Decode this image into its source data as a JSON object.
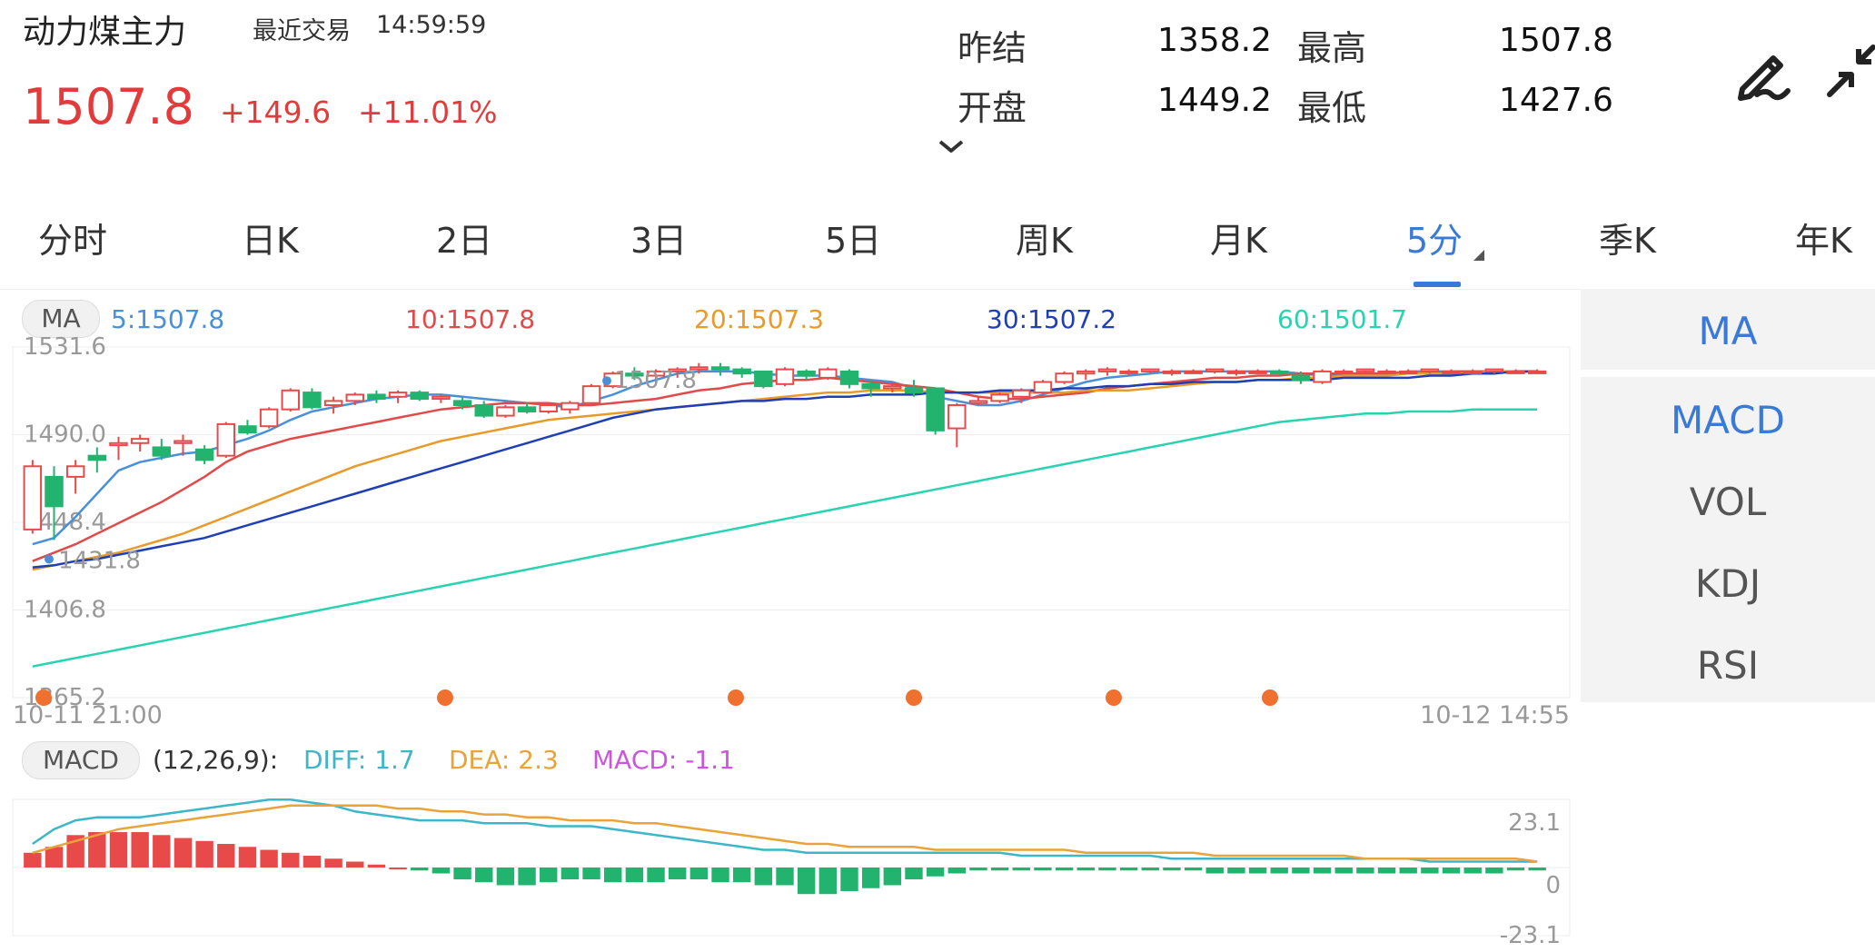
{
  "header": {
    "title": "动力煤主力",
    "last_trade_label": "最近交易",
    "last_trade_time": "14:59:59",
    "price": "1507.8",
    "change": "+149.6",
    "change_pct": "+11.01%",
    "quote": [
      {
        "label": "昨结",
        "value": "1358.2"
      },
      {
        "label": "最高",
        "value": "1507.8"
      },
      {
        "label": "开盘",
        "value": "1449.2"
      },
      {
        "label": "最低",
        "value": "1427.6"
      }
    ],
    "icons": [
      "chevron-down-icon",
      "pen-icon",
      "collapse-icon"
    ]
  },
  "tabs": {
    "items": [
      "分时",
      "日K",
      "2日",
      "3日",
      "5日",
      "周K",
      "月K",
      "5分",
      "季K",
      "年K"
    ],
    "active": "5分"
  },
  "indicators": {
    "items": [
      "MA",
      "MACD",
      "VOL",
      "KDJ",
      "RSI"
    ],
    "active_main": "MA",
    "active_sub": "MACD"
  },
  "ma_legend": {
    "label": "MA",
    "items": [
      {
        "text": "5:1507.8",
        "color": "#4a90d9"
      },
      {
        "text": "10:1507.8",
        "color": "#e04a4a"
      },
      {
        "text": "20:1507.3",
        "color": "#e89a2a"
      },
      {
        "text": "30:1507.2",
        "color": "#1f3fb4"
      },
      {
        "text": "60:1501.7",
        "color": "#29d3b0"
      }
    ]
  },
  "macd_legend": {
    "label": "MACD",
    "params": "(12,26,9):",
    "diff": "DIFF: 1.7",
    "dea": "DEA: 2.3",
    "macd": "MACD: -1.1"
  },
  "colors": {
    "up": "#e84a4a",
    "down": "#22b46e",
    "accent": "#3a7ad6",
    "ma5": "#4a90d9",
    "ma10": "#e04a4a",
    "ma20": "#e89a2a",
    "ma30": "#1f3fb4",
    "ma60": "#29d3b0",
    "diff": "#3cb6c8",
    "dea": "#e8a33a",
    "marker": "#f07030"
  },
  "chart_data": [
    {
      "type": "candlestick",
      "y_ticks": [
        1531.6,
        1490.0,
        1448.4,
        1406.8,
        1365.2
      ],
      "ylim": [
        1365.2,
        1531.6
      ],
      "x_start_label": "10-11 21:00",
      "x_end_label": "10-12 14:55",
      "annotations": {
        "high": "1507.8",
        "low": "1431.8"
      },
      "marker_count": 6,
      "candles": [
        [
          1445,
          1478,
          1443,
          1475
        ],
        [
          1470,
          1475,
          1440,
          1456
        ],
        [
          1470,
          1478,
          1462,
          1475
        ],
        [
          1480,
          1484,
          1472,
          1478
        ],
        [
          1485,
          1489,
          1478,
          1486
        ],
        [
          1486,
          1490,
          1482,
          1488
        ],
        [
          1484,
          1488,
          1478,
          1480
        ],
        [
          1486,
          1490,
          1480,
          1487
        ],
        [
          1483,
          1485,
          1476,
          1478
        ],
        [
          1480,
          1496,
          1479,
          1495
        ],
        [
          1494,
          1497,
          1490,
          1491
        ],
        [
          1494,
          1503,
          1493,
          1502
        ],
        [
          1502,
          1512,
          1501,
          1511
        ],
        [
          1510,
          1512,
          1502,
          1503
        ],
        [
          1504,
          1508,
          1500,
          1506
        ],
        [
          1506,
          1510,
          1504,
          1509
        ],
        [
          1509,
          1511,
          1505,
          1507
        ],
        [
          1508,
          1511,
          1505,
          1510
        ],
        [
          1510,
          1511,
          1506,
          1507
        ],
        [
          1507,
          1509,
          1505,
          1508
        ],
        [
          1506,
          1508,
          1502,
          1504
        ],
        [
          1504,
          1506,
          1498,
          1499
        ],
        [
          1499,
          1504,
          1498,
          1503
        ],
        [
          1503,
          1505,
          1500,
          1501
        ],
        [
          1501,
          1505,
          1500,
          1504
        ],
        [
          1502,
          1506,
          1500,
          1505
        ],
        [
          1505,
          1514,
          1504,
          1513
        ],
        [
          1513,
          1520,
          1512,
          1519
        ],
        [
          1519,
          1522,
          1516,
          1518
        ],
        [
          1518,
          1521,
          1515,
          1520
        ],
        [
          1520,
          1522,
          1517,
          1521
        ],
        [
          1521,
          1524,
          1519,
          1522
        ],
        [
          1522,
          1524,
          1518,
          1521
        ],
        [
          1521,
          1522,
          1517,
          1519
        ],
        [
          1520,
          1520,
          1512,
          1513
        ],
        [
          1514,
          1522,
          1513,
          1521
        ],
        [
          1520,
          1521,
          1516,
          1518
        ],
        [
          1517,
          1522,
          1516,
          1521
        ],
        [
          1520,
          1521,
          1512,
          1514
        ],
        [
          1514,
          1516,
          1508,
          1512
        ],
        [
          1512,
          1515,
          1510,
          1513
        ],
        [
          1512,
          1516,
          1508,
          1510
        ],
        [
          1512,
          1512,
          1490,
          1492
        ],
        [
          1493,
          1505,
          1484,
          1504
        ],
        [
          1505,
          1508,
          1504,
          1506
        ],
        [
          1506,
          1510,
          1505,
          1509
        ],
        [
          1508,
          1512,
          1505,
          1511
        ],
        [
          1510,
          1516,
          1509,
          1515
        ],
        [
          1515,
          1520,
          1514,
          1519
        ],
        [
          1519,
          1521,
          1516,
          1520
        ],
        [
          1520,
          1522,
          1518,
          1521
        ],
        [
          1520,
          1521,
          1518,
          1520
        ],
        [
          1520,
          1521,
          1519,
          1521
        ],
        [
          1520,
          1521,
          1518,
          1520
        ],
        [
          1520,
          1521,
          1519,
          1520
        ],
        [
          1520,
          1521,
          1519,
          1521
        ],
        [
          1520,
          1521,
          1518,
          1520
        ],
        [
          1520,
          1521,
          1519,
          1520
        ],
        [
          1520,
          1521,
          1518,
          1519
        ],
        [
          1518,
          1520,
          1514,
          1516
        ],
        [
          1515,
          1521,
          1514,
          1520
        ],
        [
          1520,
          1521,
          1519,
          1520
        ],
        [
          1520,
          1521,
          1519,
          1521
        ],
        [
          1520,
          1521,
          1519,
          1520
        ],
        [
          1520,
          1521,
          1519,
          1520
        ],
        [
          1520,
          1521,
          1519,
          1521
        ],
        [
          1520,
          1521,
          1519,
          1520
        ],
        [
          1520,
          1521,
          1519,
          1520
        ],
        [
          1520,
          1521,
          1519,
          1521
        ],
        [
          1520,
          1521,
          1519,
          1520
        ],
        [
          1520,
          1521,
          1519,
          1520
        ]
      ],
      "series": [
        {
          "name": "5",
          "values": [
            1438,
            1441,
            1451,
            1462,
            1473,
            1477,
            1479,
            1481,
            1482,
            1485,
            1488,
            1492,
            1497,
            1501,
            1503,
            1505,
            1507,
            1508,
            1509,
            1509,
            1508,
            1507,
            1506,
            1505,
            1504,
            1503,
            1506,
            1509,
            1513,
            1516,
            1519,
            1520,
            1520,
            1520,
            1519,
            1518,
            1518,
            1518,
            1517,
            1516,
            1515,
            1512,
            1508,
            1506,
            1504,
            1504,
            1506,
            1509,
            1512,
            1515,
            1517,
            1518,
            1519,
            1520,
            1520,
            1520,
            1520,
            1520,
            1520,
            1519,
            1518,
            1518,
            1518,
            1519,
            1520,
            1520,
            1520,
            1520,
            1520,
            1520,
            1520
          ]
        },
        {
          "name": "10",
          "values": [
            1430,
            1434,
            1438,
            1443,
            1448,
            1453,
            1458,
            1464,
            1470,
            1477,
            1482,
            1485,
            1488,
            1490,
            1492,
            1494,
            1496,
            1498,
            1500,
            1502,
            1503,
            1504,
            1505,
            1505,
            1505,
            1504,
            1504,
            1505,
            1506,
            1507,
            1509,
            1511,
            1512,
            1514,
            1515,
            1516,
            1516,
            1517,
            1516,
            1515,
            1514,
            1513,
            1512,
            1510,
            1508,
            1507,
            1507,
            1508,
            1509,
            1510,
            1512,
            1513,
            1514,
            1515,
            1516,
            1517,
            1517,
            1518,
            1518,
            1519,
            1519,
            1519,
            1519,
            1519,
            1519,
            1519,
            1520,
            1520,
            1520,
            1520,
            1520
          ]
        },
        {
          "name": "20",
          "values": [
            1426,
            1428,
            1430,
            1432,
            1434,
            1437,
            1440,
            1443,
            1447,
            1451,
            1455,
            1459,
            1463,
            1467,
            1471,
            1475,
            1478,
            1481,
            1484,
            1487,
            1489,
            1491,
            1493,
            1495,
            1497,
            1498,
            1499,
            1500,
            1501,
            1502,
            1503,
            1504,
            1505,
            1506,
            1507,
            1508,
            1509,
            1510,
            1510,
            1511,
            1511,
            1511,
            1510,
            1510,
            1510,
            1510,
            1510,
            1510,
            1510,
            1511,
            1511,
            1511,
            1512,
            1513,
            1514,
            1515,
            1515,
            1516,
            1516,
            1517,
            1517,
            1518,
            1518,
            1518,
            1519,
            1519,
            1519,
            1519,
            1520,
            1520,
            1520
          ]
        },
        {
          "name": "30",
          "values": [
            1427,
            1428,
            1430,
            1431,
            1433,
            1435,
            1437,
            1439,
            1441,
            1444,
            1447,
            1450,
            1453,
            1456,
            1459,
            1462,
            1465,
            1468,
            1471,
            1474,
            1477,
            1480,
            1483,
            1486,
            1489,
            1492,
            1495,
            1498,
            1500,
            1502,
            1503,
            1504,
            1505,
            1506,
            1506,
            1507,
            1507,
            1508,
            1508,
            1509,
            1509,
            1509,
            1510,
            1510,
            1510,
            1511,
            1511,
            1511,
            1512,
            1512,
            1513,
            1513,
            1514,
            1514,
            1515,
            1515,
            1515,
            1516,
            1516,
            1516,
            1516,
            1517,
            1517,
            1517,
            1517,
            1518,
            1518,
            1519,
            1519,
            1520,
            1520
          ]
        },
        {
          "name": "60",
          "values": [
            1380,
            1382,
            1384,
            1386,
            1388,
            1390,
            1392,
            1394,
            1396,
            1398,
            1400,
            1402,
            1404,
            1406,
            1408,
            1410,
            1412,
            1414,
            1416,
            1418,
            1420,
            1422,
            1424,
            1426,
            1428,
            1430,
            1432,
            1434,
            1436,
            1438,
            1440,
            1442,
            1444,
            1446,
            1448,
            1450,
            1452,
            1454,
            1456,
            1458,
            1460,
            1462,
            1464,
            1466,
            1468,
            1470,
            1472,
            1474,
            1476,
            1478,
            1480,
            1482,
            1484,
            1486,
            1488,
            1490,
            1492,
            1494,
            1496,
            1497,
            1498,
            1499,
            1500,
            1500,
            1501,
            1501,
            1501,
            1502,
            1502,
            1502,
            1502
          ]
        }
      ]
    },
    {
      "type": "macd",
      "y_ticks": [
        23.1,
        0,
        -23.1
      ],
      "ylim": [
        -23.1,
        23.1
      ],
      "hist": [
        5,
        7,
        11,
        12,
        12,
        12,
        11,
        10,
        9,
        8,
        7,
        6,
        5,
        4,
        3,
        2,
        1,
        0,
        -1,
        -2,
        -4,
        -5,
        -6,
        -6,
        -5,
        -4,
        -4,
        -5,
        -5,
        -5,
        -4,
        -4,
        -5,
        -5,
        -6,
        -6,
        -9,
        -9,
        -8,
        -7,
        -6,
        -4,
        -3,
        -2,
        -1,
        -1,
        -1,
        -1,
        -1,
        -1,
        -1,
        -1,
        -1,
        -1,
        -1,
        -2,
        -2,
        -2,
        -2,
        -2,
        -2,
        -2,
        -2,
        -2,
        -2,
        -2,
        -2,
        -2,
        -2,
        -1,
        -1
      ],
      "diff": [
        8,
        13,
        16,
        17,
        17,
        17,
        18,
        19,
        20,
        21,
        22,
        23,
        23,
        22,
        21,
        19,
        18,
        17,
        16,
        16,
        16,
        15,
        15,
        15,
        14,
        14,
        14,
        13,
        12,
        11,
        10,
        9,
        8,
        7,
        6,
        6,
        5,
        5,
        5,
        5,
        5,
        5,
        5,
        5,
        5,
        5,
        4,
        4,
        4,
        4,
        4,
        4,
        4,
        3,
        3,
        3,
        3,
        3,
        3,
        3,
        3,
        3,
        3,
        3,
        3,
        2,
        2,
        2,
        2,
        2,
        2
      ],
      "dea": [
        5,
        7,
        9,
        11,
        13,
        14,
        15,
        16,
        17,
        18,
        19,
        20,
        21,
        21,
        21,
        21,
        21,
        20,
        20,
        19,
        19,
        18,
        18,
        17,
        17,
        16,
        16,
        16,
        15,
        15,
        14,
        13,
        12,
        11,
        10,
        9,
        8,
        8,
        7,
        7,
        7,
        7,
        6,
        6,
        6,
        6,
        6,
        6,
        6,
        5,
        5,
        5,
        5,
        5,
        5,
        4,
        4,
        4,
        4,
        4,
        4,
        4,
        3,
        3,
        3,
        3,
        3,
        3,
        3,
        3,
        2
      ]
    }
  ]
}
